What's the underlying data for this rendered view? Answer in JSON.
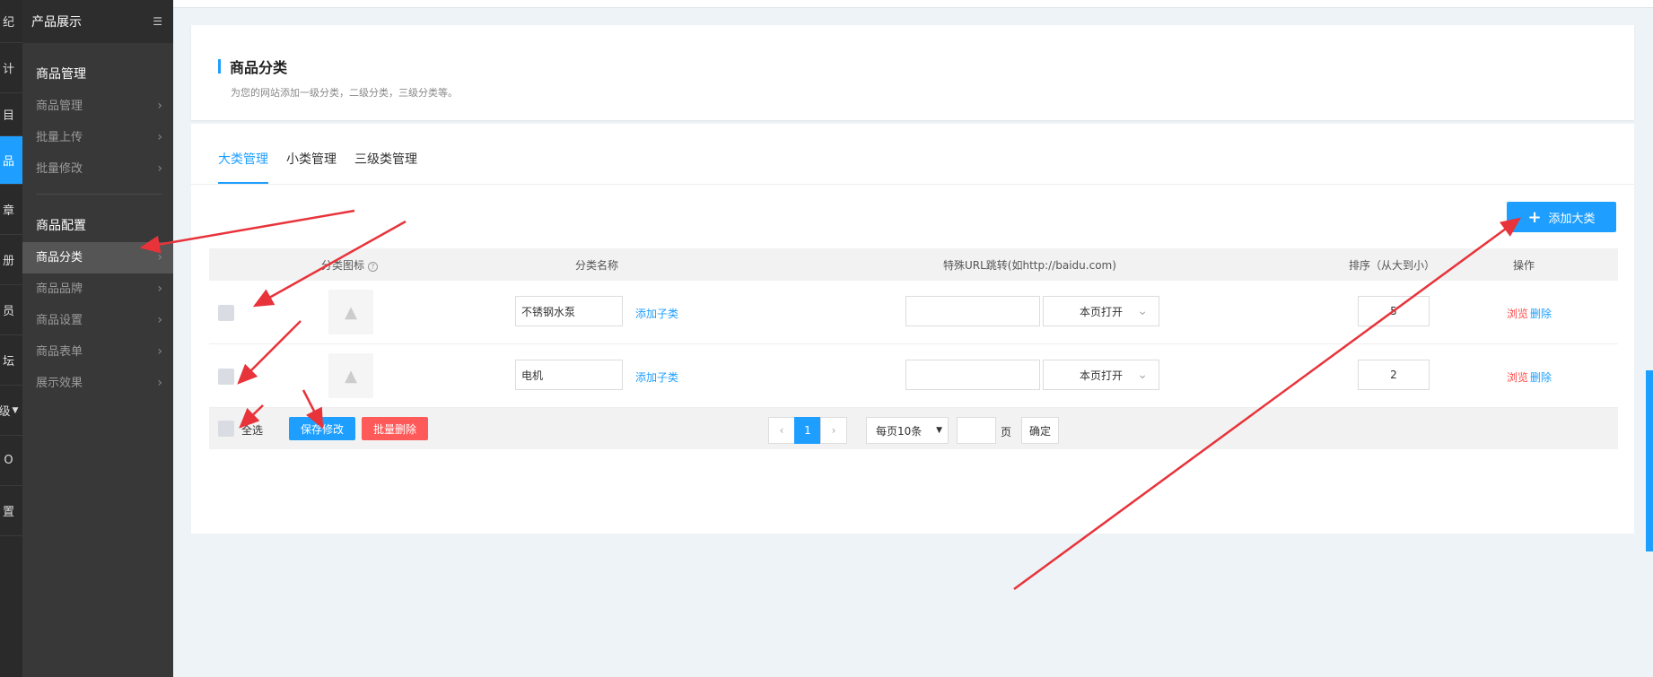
{
  "rail": [
    "纪",
    "计",
    "目",
    "品",
    "章",
    "册",
    "员",
    "坛",
    "级",
    "O",
    "置"
  ],
  "sidebar": {
    "title": "产品展示",
    "groups": [
      {
        "label": "商品管理",
        "items": [
          "商品管理",
          "批量上传",
          "批量修改"
        ]
      },
      {
        "label": "商品配置",
        "items": [
          "商品分类",
          "商品品牌",
          "商品设置",
          "商品表单",
          "展示效果"
        ]
      }
    ],
    "active_item": "商品分类"
  },
  "header": {
    "title": "商品分类",
    "subtitle": "为您的网站添加一级分类，二级分类，三级分类等。"
  },
  "tabs": [
    "大类管理",
    "小类管理",
    "三级类管理"
  ],
  "active_tab": "大类管理",
  "add_button": "添加大类",
  "table": {
    "columns": [
      "分类图标",
      "分类名称",
      "特殊URL跳转(如http://baidu.com)",
      "排序（从大到小）",
      "操作"
    ],
    "rows": [
      {
        "name": "不锈钢水泵",
        "add_sub": "添加子类",
        "url": "",
        "target": "本页打开",
        "order": "5",
        "browse": "浏览",
        "delete": "删除"
      },
      {
        "name": "电机",
        "add_sub": "添加子类",
        "url": "",
        "target": "本页打开",
        "order": "2",
        "browse": "浏览",
        "delete": "删除"
      }
    ],
    "select_all": "全选",
    "save": "保存修改",
    "batch_delete": "批量删除"
  },
  "pagination": {
    "prev": "‹",
    "current": "1",
    "next": "›",
    "per_page": "每页10条",
    "page_unit": "页",
    "confirm": "确定"
  },
  "colors": {
    "accent": "#1e9fff",
    "danger": "#ff4a4a",
    "annotation": "#e8333a"
  }
}
